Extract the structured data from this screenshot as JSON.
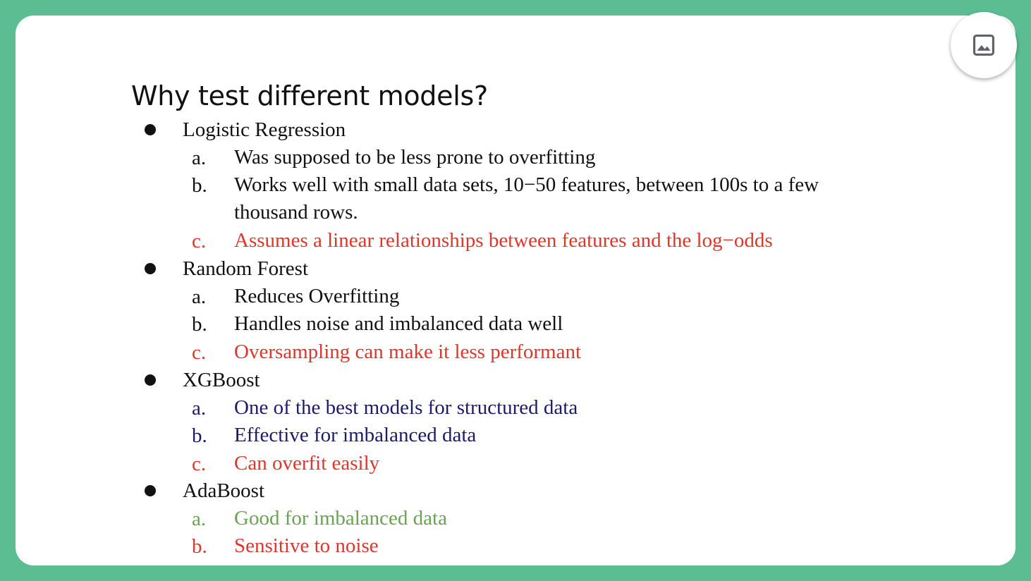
{
  "slide": {
    "title": "Why test different models?",
    "image_button_icon": "image-icon",
    "colors": {
      "frame": "#5cbd93",
      "default_text": "#111111",
      "red": "#e0352b",
      "navy": "#1b1a6b",
      "green": "#6aa350"
    },
    "models": [
      {
        "name": "Logistic Regression",
        "points": [
          {
            "marker": "a.",
            "text": "Was supposed to be less prone to overfitting",
            "color": "#111111"
          },
          {
            "marker": "b.",
            "text": "Works well with small data sets, 10−50 features, between 100s to a few thousand rows.",
            "color": "#111111"
          },
          {
            "marker": "c.",
            "text": "Assumes a linear relationships between features and the log−odds",
            "color": "#e0352b"
          }
        ]
      },
      {
        "name": "Random Forest",
        "points": [
          {
            "marker": "a.",
            "text": "Reduces Overfitting",
            "color": "#111111"
          },
          {
            "marker": "b.",
            "text": "Handles noise and  imbalanced data well",
            "color": "#111111"
          },
          {
            "marker": "c.",
            "text": "Oversampling can make it less performant",
            "color": "#e0352b"
          }
        ]
      },
      {
        "name": "XGBoost",
        "points": [
          {
            "marker": "a.",
            "text": "One of the best models for structured data",
            "color": "#1b1a6b"
          },
          {
            "marker": "b.",
            "text": "Effective for imbalanced data",
            "color": "#1b1a6b"
          },
          {
            "marker": "c.",
            "text": "Can overfit easily",
            "color": "#e0352b"
          }
        ]
      },
      {
        "name": "AdaBoost",
        "points": [
          {
            "marker": "a.",
            "text": "Good for imbalanced data",
            "color": "#6aa350"
          },
          {
            "marker": "b.",
            "text": "Sensitive to noise",
            "color": "#e0352b"
          }
        ]
      }
    ]
  }
}
